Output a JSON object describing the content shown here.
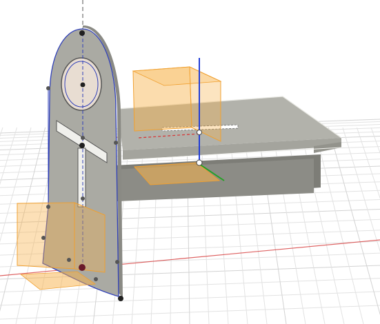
{
  "viewport": {
    "label": "",
    "background": "#ffffff"
  },
  "colors": {
    "grid": "#e2e2e2",
    "grid_major": "#d2d2d2",
    "x_axis": "#d63a3a",
    "y_axis": "#20a320",
    "z_axis": "#1f3cd8",
    "body_face": "#a9a9a2",
    "body_top": "#c7c7c0",
    "body_side": "#92928b",
    "body_dark": "#7d7d77",
    "selection_fill": "#f7b24a",
    "selection_edge": "#f0a030",
    "sketch_line": "#2f3fb8",
    "point": "#202020"
  },
  "icons": {
    "origin": "origin-point-icon",
    "sketch_point": "sketch-point-icon",
    "axis_handle": "axis-handle-icon"
  }
}
